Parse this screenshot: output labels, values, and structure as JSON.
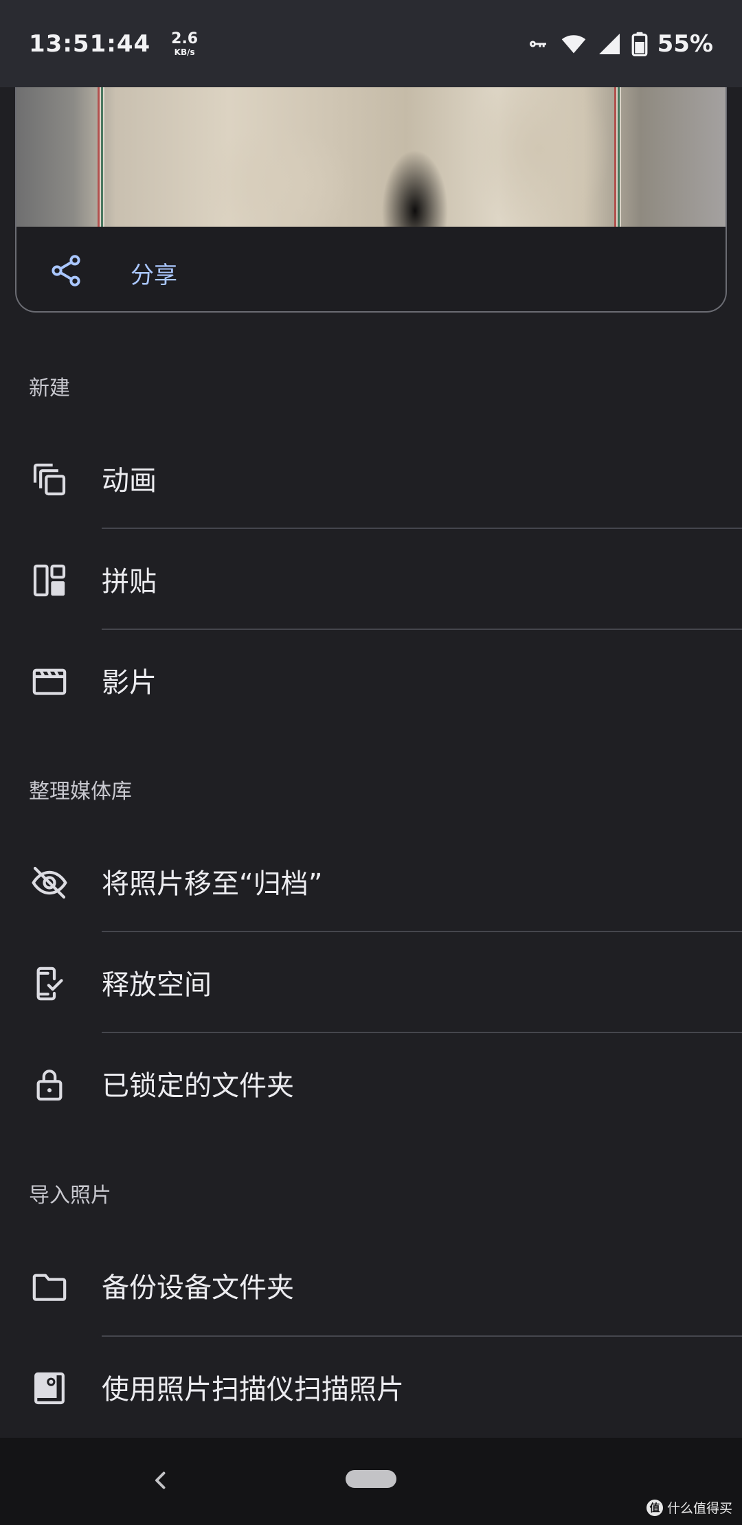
{
  "status_bar": {
    "time": "13:51:44",
    "net_speed_value": "2.6",
    "net_speed_unit": "KB/s",
    "battery_percent": "55%",
    "icons": [
      "vpn-key-icon",
      "wifi-icon",
      "cellular-signal-icon",
      "battery-icon"
    ]
  },
  "photo_card": {
    "share_label": "分享",
    "share_icon": "share-icon",
    "accent_color": "#aac7ff"
  },
  "sections": [
    {
      "header": "新建",
      "items": [
        {
          "label": "动画",
          "icon": "animation-icon"
        },
        {
          "label": "拼贴",
          "icon": "collage-icon"
        },
        {
          "label": "影片",
          "icon": "movie-icon"
        }
      ]
    },
    {
      "header": "整理媒体库",
      "items": [
        {
          "label": "将照片移至“归档”",
          "icon": "archive-eye-off-icon"
        },
        {
          "label": "释放空间",
          "icon": "phone-check-icon"
        },
        {
          "label": "已锁定的文件夹",
          "icon": "lock-icon"
        }
      ]
    },
    {
      "header": "导入照片",
      "items": [
        {
          "label": "备份设备文件夹",
          "icon": "folder-icon"
        },
        {
          "label": "使用照片扫描仪扫描照片",
          "icon": "photo-scan-icon"
        }
      ]
    }
  ],
  "nav_bar": {
    "back_icon": "back-chevron-icon",
    "home_icon": "home-pill-icon"
  },
  "watermark": {
    "badge": "值",
    "text": "什么值得买"
  }
}
